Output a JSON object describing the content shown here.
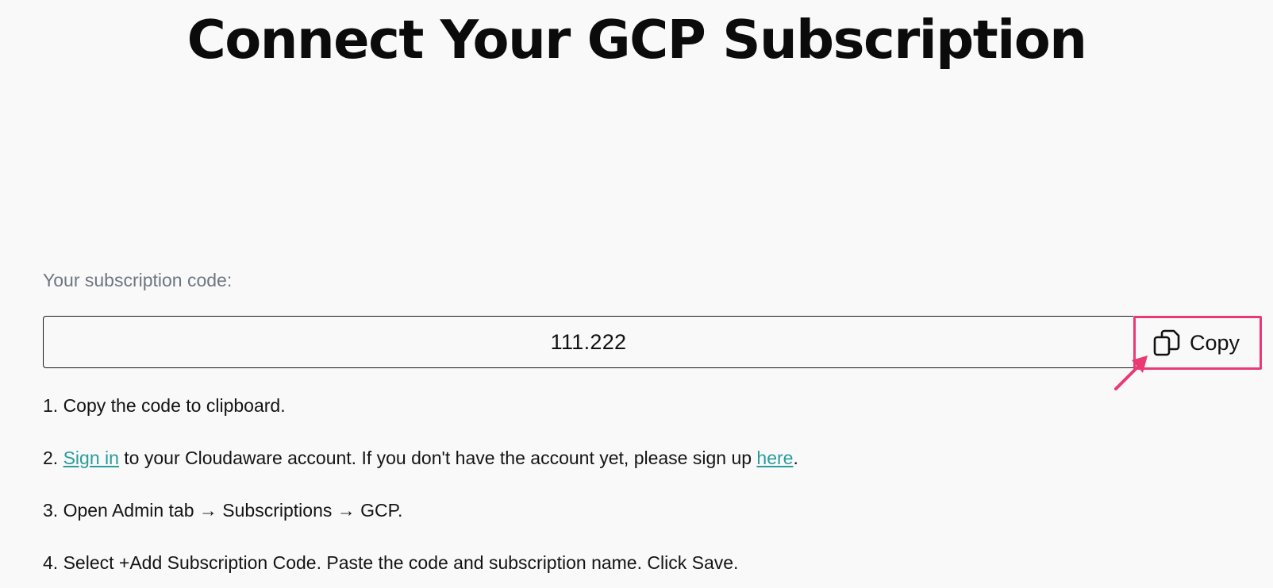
{
  "page": {
    "title": "Connect Your GCP Subscription"
  },
  "subscription": {
    "label": "Your subscription code:",
    "code": "111.222",
    "copy_label": "Copy"
  },
  "steps": {
    "step1": {
      "text": "1. Copy the code to clipboard."
    },
    "step2": {
      "prefix": "2. ",
      "link_sign_in": "Sign in",
      "middle": " to your Cloudaware account. If you don't have the account yet, please sign up ",
      "link_here": "here",
      "suffix": "."
    },
    "step3": {
      "text": "3. Open Admin tab → Subscriptions → GCP."
    },
    "step4": {
      "text": "4. Select +Add Subscription Code. Paste the code and subscription name. Click Save."
    }
  },
  "colors": {
    "highlight": "#ea3a74",
    "link": "#2a9d9b",
    "label": "#6e7680"
  },
  "icons": {
    "copy": "copy-icon",
    "annotation": "pointer-arrow-icon"
  }
}
